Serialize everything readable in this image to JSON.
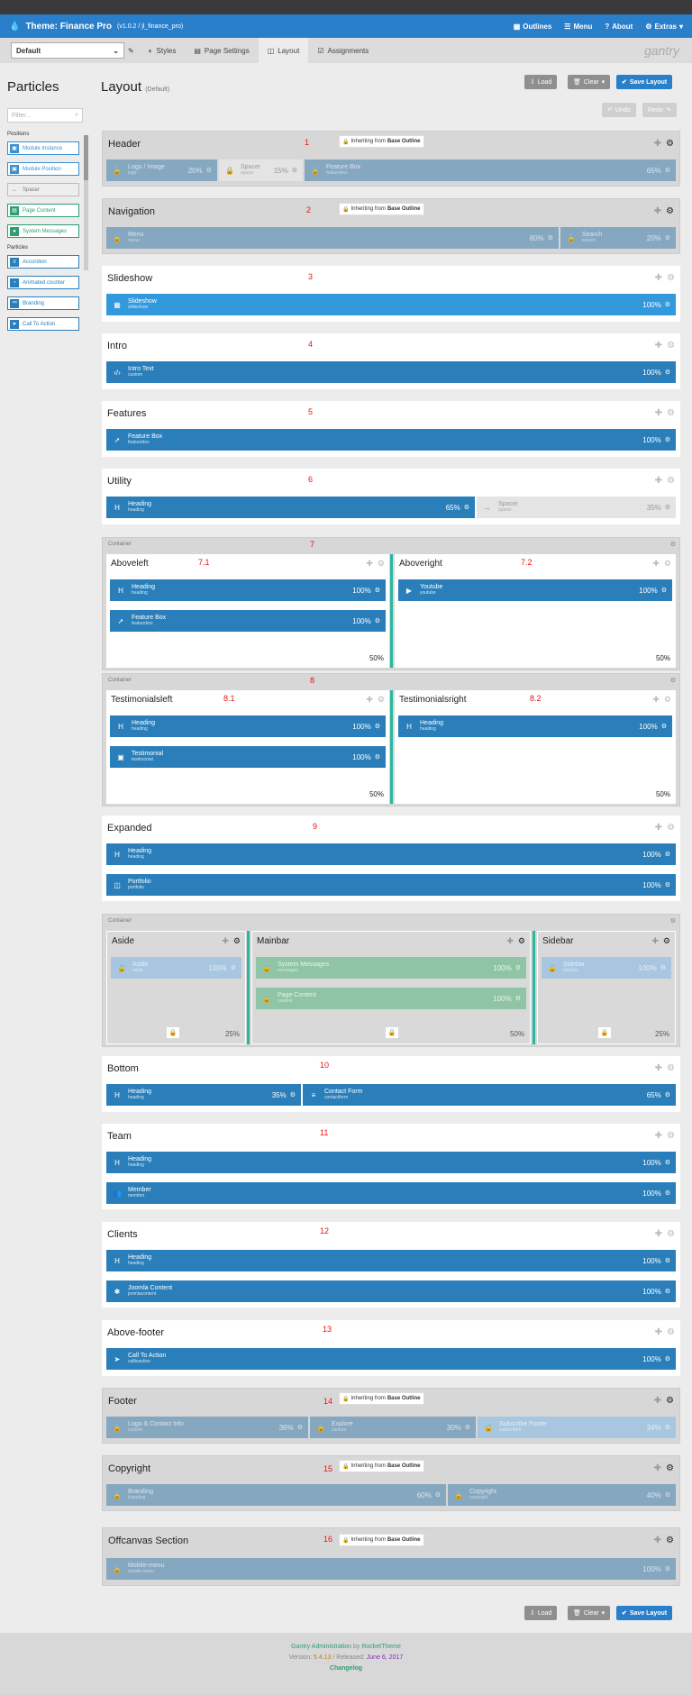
{
  "topbar": {
    "title": "Theme: Finance Pro",
    "version": "(v1.0.2 / jl_finance_pro)",
    "nav": [
      "Outlines",
      "Menu",
      "About",
      "Extras"
    ]
  },
  "subbar": {
    "outline": "Default",
    "tabs": [
      "Styles",
      "Page Settings",
      "Layout",
      "Assignments"
    ],
    "logo": "gantry"
  },
  "sidebar": {
    "title": "Particles",
    "filter_placeholder": "Filter...",
    "positions_label": "Positions",
    "positions": [
      "Module Instance",
      "Module Position",
      "Spacer",
      "Page Content",
      "System Messages"
    ],
    "particles_label": "Particles",
    "particles": [
      "Accordion",
      "Animated counter",
      "Branding",
      "Call To Action"
    ]
  },
  "page": {
    "title": "Layout",
    "subtitle": "(Default)",
    "load": "Load",
    "clear": "Clear",
    "save": "Save Layout",
    "undo": "Undo",
    "redo": "Redo"
  },
  "inherit": {
    "prefix": "Inheriting from",
    "source": "Base Outline"
  },
  "container_label": "Container",
  "sections": {
    "header": {
      "title": "Header",
      "num": "1",
      "blocks": [
        {
          "name": "Logo / Image",
          "sub": "logo",
          "pct": "20%"
        },
        {
          "name": "Spacer",
          "sub": "spacer",
          "pct": "15%"
        },
        {
          "name": "Feature Box",
          "sub": "featurebox",
          "pct": "65%"
        }
      ]
    },
    "navigation": {
      "title": "Navigation",
      "num": "2",
      "blocks": [
        {
          "name": "Menu",
          "sub": "menu",
          "pct": "80%"
        },
        {
          "name": "Search",
          "sub": "search",
          "pct": "20%"
        }
      ]
    },
    "slideshow": {
      "title": "Slideshow",
      "num": "3",
      "blocks": [
        {
          "name": "Slideshow",
          "sub": "slideshow",
          "pct": "100%"
        }
      ]
    },
    "intro": {
      "title": "Intro",
      "num": "4",
      "blocks": [
        {
          "name": "Intro Text",
          "sub": "custom",
          "pct": "100%"
        }
      ]
    },
    "features": {
      "title": "Features",
      "num": "5",
      "blocks": [
        {
          "name": "Feature Box",
          "sub": "featurebox",
          "pct": "100%"
        }
      ]
    },
    "utility": {
      "title": "Utility",
      "num": "6",
      "blocks": [
        {
          "name": "Heading",
          "sub": "heading",
          "pct": "65%"
        },
        {
          "name": "Spacer",
          "sub": "spacer",
          "pct": "35%"
        }
      ]
    },
    "c7": {
      "num": "7",
      "left": {
        "title": "Aboveleft",
        "num": "7.1",
        "pct": "50%",
        "blocks": [
          {
            "name": "Heading",
            "sub": "heading",
            "pct": "100%"
          },
          {
            "name": "Feature Box",
            "sub": "featurebox",
            "pct": "100%"
          }
        ]
      },
      "right": {
        "title": "Aboveright",
        "num": "7.2",
        "pct": "50%",
        "blocks": [
          {
            "name": "Youtube",
            "sub": "youtube",
            "pct": "100%"
          }
        ]
      }
    },
    "c8": {
      "num": "8",
      "left": {
        "title": "Testimonialsleft",
        "num": "8.1",
        "pct": "50%",
        "blocks": [
          {
            "name": "Heading",
            "sub": "heading",
            "pct": "100%"
          },
          {
            "name": "Testimonial",
            "sub": "testimonial",
            "pct": "100%"
          }
        ]
      },
      "right": {
        "title": "Testimonialsright",
        "num": "8.2",
        "pct": "50%",
        "blocks": [
          {
            "name": "Heading",
            "sub": "heading",
            "pct": "100%"
          }
        ]
      }
    },
    "expanded": {
      "title": "Expanded",
      "num": "9",
      "blocks": [
        {
          "name": "Heading",
          "sub": "heading",
          "pct": "100%"
        },
        {
          "name": "Portfolio",
          "sub": "portfolio",
          "pct": "100%"
        }
      ]
    },
    "cmain": {
      "aside": {
        "title": "Aside",
        "pct": "25%",
        "blocks": [
          {
            "name": "Aside",
            "sub": "aside",
            "pct": "100%"
          }
        ]
      },
      "mainbar": {
        "title": "Mainbar",
        "pct": "50%",
        "blocks": [
          {
            "name": "System Messages",
            "sub": "messages",
            "pct": "100%"
          },
          {
            "name": "Page Content",
            "sub": "content",
            "pct": "100%"
          }
        ]
      },
      "sidebar": {
        "title": "Sidebar",
        "pct": "25%",
        "blocks": [
          {
            "name": "Sidebar",
            "sub": "sidebar",
            "pct": "100%"
          }
        ]
      }
    },
    "bottom": {
      "title": "Bottom",
      "num": "10",
      "blocks": [
        {
          "name": "Heading",
          "sub": "heading",
          "pct": "35%"
        },
        {
          "name": "Contact Form",
          "sub": "contactform",
          "pct": "65%"
        }
      ]
    },
    "team": {
      "title": "Team",
      "num": "11",
      "blocks": [
        {
          "name": "Heading",
          "sub": "heading",
          "pct": "100%"
        },
        {
          "name": "Member",
          "sub": "member",
          "pct": "100%"
        }
      ]
    },
    "clients": {
      "title": "Clients",
      "num": "12",
      "blocks": [
        {
          "name": "Heading",
          "sub": "heading",
          "pct": "100%"
        },
        {
          "name": "Joomla Content",
          "sub": "joomlacontent",
          "pct": "100%"
        }
      ]
    },
    "abovefooter": {
      "title": "Above-footer",
      "num": "13",
      "blocks": [
        {
          "name": "Call To Action",
          "sub": "calltoaction",
          "pct": "100%"
        }
      ]
    },
    "footer": {
      "title": "Footer",
      "num": "14",
      "blocks": [
        {
          "name": "Logo & Contact Info",
          "sub": "custom",
          "pct": "36%"
        },
        {
          "name": "Explore",
          "sub": "custom",
          "pct": "30%"
        },
        {
          "name": "Subscribe Footer",
          "sub": "subscribeft",
          "pct": "34%"
        }
      ]
    },
    "copyright": {
      "title": "Copyright",
      "num": "15",
      "blocks": [
        {
          "name": "Branding",
          "sub": "branding",
          "pct": "60%"
        },
        {
          "name": "Copyright",
          "sub": "copyright",
          "pct": "40%"
        }
      ]
    },
    "offcanvas": {
      "title": "Offcanvas Section",
      "num": "16",
      "blocks": [
        {
          "name": "Mobile-menu",
          "sub": "mobile-menu",
          "pct": "100%"
        }
      ]
    }
  },
  "footer": {
    "admin": "Gantry Administration",
    "by": "by",
    "company": "RocketTheme",
    "version_label": "Version:",
    "version": "5.4.13",
    "released_label": "/ Released:",
    "released": "June 6, 2017",
    "changelog": "Changelog"
  }
}
